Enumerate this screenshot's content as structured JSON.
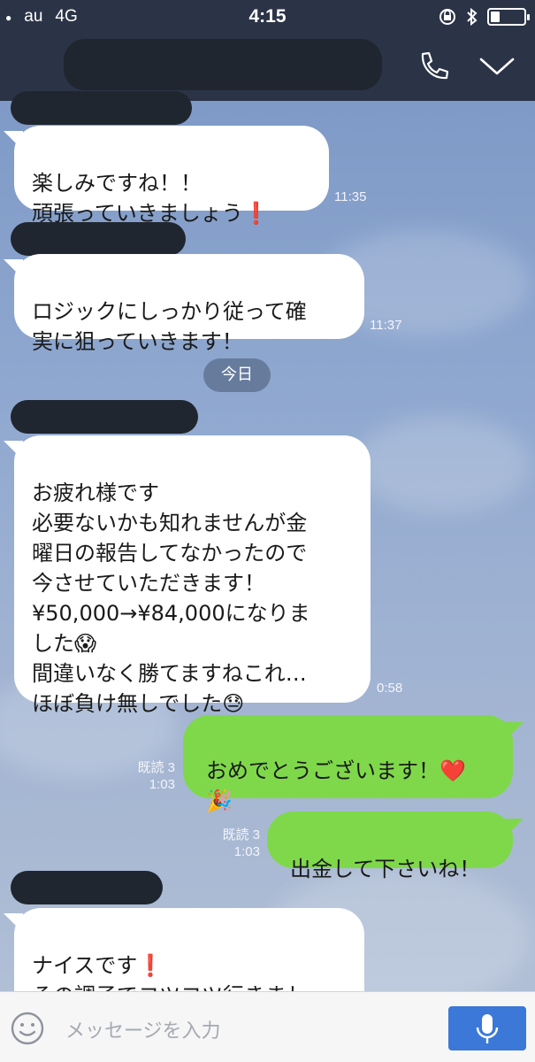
{
  "status_bar": {
    "carrier": "au",
    "network": "4G",
    "time": "4:15",
    "battery_level": 0.25,
    "icons": [
      "rotation-lock-icon",
      "bluetooth-icon",
      "battery-icon"
    ]
  },
  "header": {
    "icons": [
      "phone-icon",
      "chevron-down-icon"
    ]
  },
  "messages": [
    {
      "lines": "楽しみですね！！\n頑張っていきましょう❗",
      "time": "11:35"
    },
    {
      "lines": "ロジックにしっかり従って確\n実に狙っていきます！",
      "time": "11:37"
    },
    {
      "lines": "お疲れ様です\n必要ないかも知れませんが金\n曜日の報告してなかったので\n今させていただきます！\n¥50,000→¥84,000になりま\nした😱\n間違いなく勝てますねこれ…\nほぼ負け無しでした😓",
      "time": "0:58"
    },
    {
      "lines": "おめでとうございます！❤️\n🎉",
      "read": "既読 3",
      "time": "1:03"
    },
    {
      "lines": "出金して下さいね！",
      "read": "既読 3",
      "time": "1:03"
    },
    {
      "lines": "ナイスです❗\nその調子でコツコツ行きまし\nょう👍"
    }
  ],
  "date_divider": "今日",
  "input": {
    "placeholder": "メッセージを入力"
  },
  "colors": {
    "header_bg": "#2b3447",
    "incoming_bubble": "#ffffff",
    "outgoing_bubble": "#7fd84a",
    "send_button": "#3b78d8"
  }
}
